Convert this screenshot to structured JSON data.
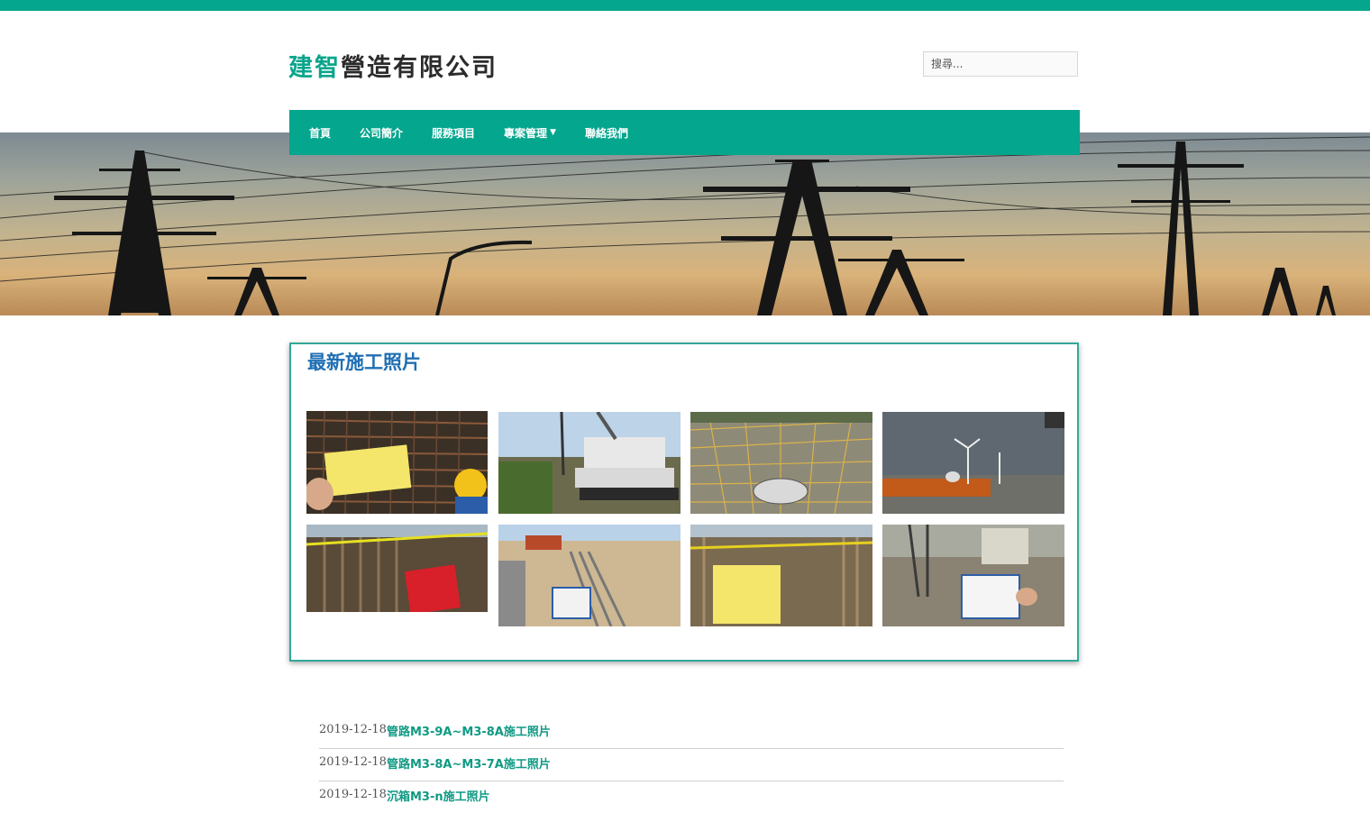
{
  "header": {
    "logo_part1": "建智",
    "logo_part2": "營造有限公司",
    "search_placeholder": "搜尋..."
  },
  "nav": {
    "items": [
      {
        "label": "首頁"
      },
      {
        "label": "公司簡介"
      },
      {
        "label": "服務項目"
      },
      {
        "label": "專案管理",
        "icon": "chevron-down-icon"
      },
      {
        "label": "聯絡我們"
      }
    ]
  },
  "gallery": {
    "title": "最新施工照片",
    "photos": [
      {
        "name": "rebar-inspection-sign"
      },
      {
        "name": "excavator-site"
      },
      {
        "name": "safety-net-pit"
      },
      {
        "name": "wind-turbines-road"
      },
      {
        "name": "trench-warning-sign"
      },
      {
        "name": "pipe-laying-trench"
      },
      {
        "name": "sheet-pile-trench-sign"
      },
      {
        "name": "drilling-rig-sign"
      }
    ]
  },
  "news": [
    {
      "date": "2019-12-18",
      "title": "管路M3-9A~M3-8A施工照片"
    },
    {
      "date": "2019-12-18",
      "title": "管路M3-8A~M3-7A施工照片"
    },
    {
      "date": "2019-12-18",
      "title": "沉箱M3-n施工照片"
    }
  ],
  "colors": {
    "brand": "#04a68d",
    "heading": "#1f6fb4",
    "link": "#0f9a84"
  }
}
